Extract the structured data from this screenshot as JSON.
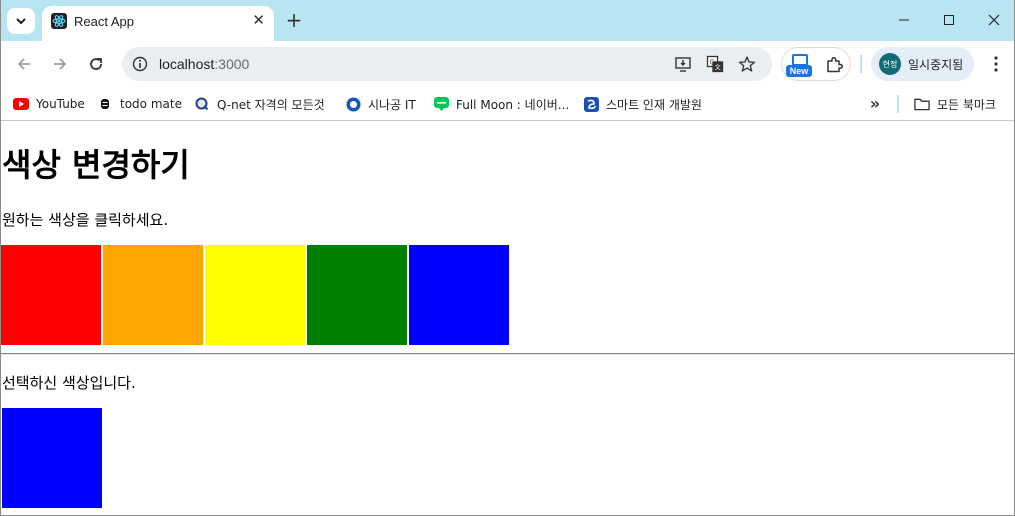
{
  "browser": {
    "tab_title": "React App",
    "url_host": "localhost",
    "url_port": ":3000",
    "profile_initials": "현정",
    "profile_label": "일시중지됨",
    "extension_badge": "New",
    "theme_color": "#b7e6f2"
  },
  "bookmarks": {
    "items": [
      {
        "label": "YouTube",
        "icon": "youtube-icon"
      },
      {
        "label": "todo mate",
        "icon": "todo-mate-icon"
      },
      {
        "label": "Q-net 자격의 모든것",
        "icon": "qnet-icon"
      },
      {
        "label": "시나공 IT",
        "icon": "sinagong-icon"
      },
      {
        "label": "Full Moon : 네이버...",
        "icon": "blog-icon"
      },
      {
        "label": "스마트 인재 개발원",
        "icon": "smart-icon"
      }
    ],
    "all_bookmarks_label": "모든 북마크"
  },
  "page": {
    "title": "색상 변경하기",
    "instruction": "원하는 색상을 클릭하세요.",
    "colors": [
      "red",
      "orange",
      "yellow",
      "green",
      "blue"
    ],
    "selected_label": "선택하신 색상입니다.",
    "selected_color": "blue"
  }
}
